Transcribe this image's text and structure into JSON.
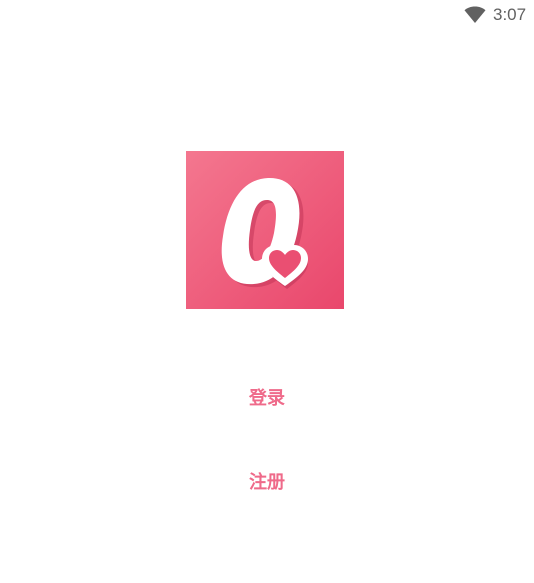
{
  "status_bar": {
    "time": "3:07",
    "wifi_icon": "wifi-icon"
  },
  "logo": {
    "icon": "app-logo",
    "brand_color": "#ed5577"
  },
  "actions": {
    "login_label": "登录",
    "register_label": "注册",
    "accent_color": "#ef6a8a"
  }
}
